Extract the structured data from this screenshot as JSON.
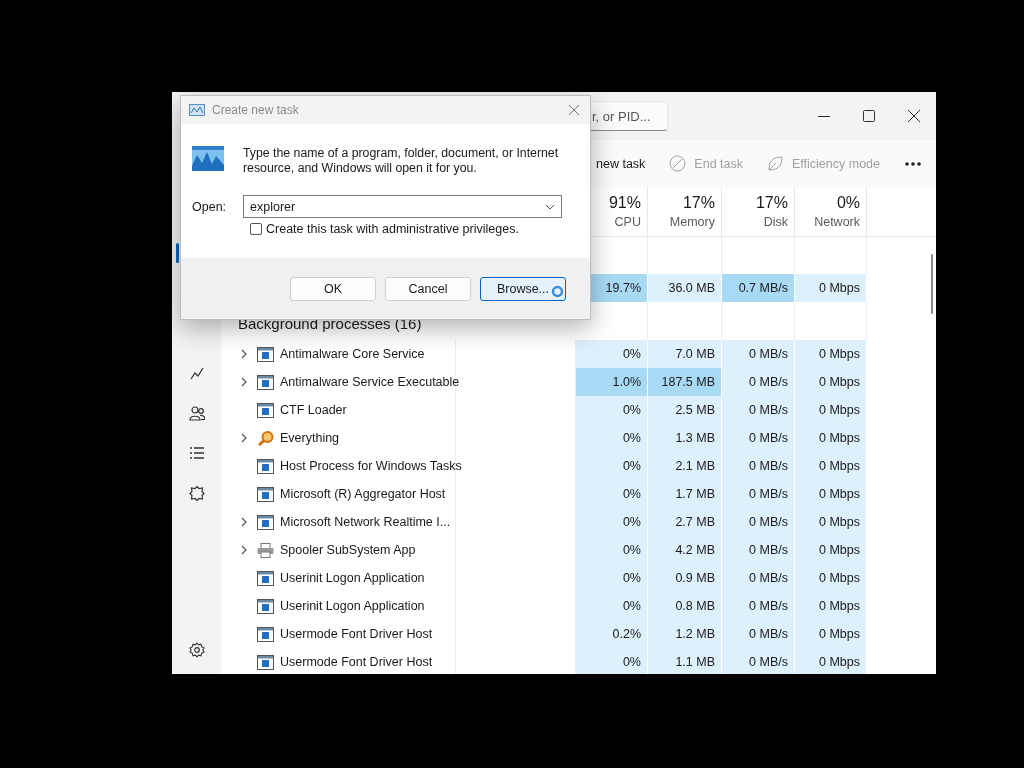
{
  "dialog": {
    "title": "Create new task",
    "message": "Type the name of a program, folder, document, or Internet resource, and Windows will open it for you.",
    "open_label": "Open:",
    "open_value": "explorer",
    "admin_label": "Create this task with administrative privileges.",
    "admin_checked": false,
    "buttons": [
      {
        "label": "OK",
        "focused": false
      },
      {
        "label": "Cancel",
        "focused": false
      },
      {
        "label": "Browse...",
        "focused": true
      }
    ]
  },
  "window": {
    "search_placeholder": "r, or PID..."
  },
  "sidebar": {
    "items": [
      {
        "kind": "processes",
        "selected": true
      },
      {
        "kind": "startup",
        "selected": false
      },
      {
        "kind": "users",
        "selected": false
      },
      {
        "kind": "details",
        "selected": false
      },
      {
        "kind": "services",
        "selected": false
      }
    ]
  },
  "toolbar": [
    {
      "kind": "text",
      "label": "new task",
      "disabled": false
    },
    {
      "kind": "end",
      "label": "End task",
      "disabled": true
    },
    {
      "kind": "leaf",
      "label": "Efficiency mode",
      "disabled": true
    },
    {
      "kind": "more"
    }
  ],
  "columns": [
    {
      "percent": "91%",
      "label": "CPU"
    },
    {
      "percent": "17%",
      "label": "Memory"
    },
    {
      "percent": "17%",
      "label": "Disk"
    },
    {
      "percent": "0%",
      "label": "Network"
    }
  ],
  "apps_row": {
    "cells": [
      {
        "text": "19.7%",
        "hot": true
      },
      {
        "text": "36.0 MB",
        "hot": false
      },
      {
        "text": "0.7 MB/s",
        "hot": true
      },
      {
        "text": "0 Mbps",
        "hot": false
      }
    ]
  },
  "group": {
    "label": "Background processes (16)"
  },
  "processes": [
    {
      "name": "Antimalware Core Service",
      "expandable": true,
      "kind": "app",
      "cells": [
        {
          "text": "0%",
          "hot": false
        },
        {
          "text": "7.0 MB",
          "hot": false
        },
        {
          "text": "0 MB/s",
          "hot": false
        },
        {
          "text": "0 Mbps",
          "hot": false
        }
      ]
    },
    {
      "name": "Antimalware Service Executable",
      "expandable": true,
      "kind": "app",
      "cells": [
        {
          "text": "1.0%",
          "hot": true
        },
        {
          "text": "187.5 MB",
          "hot": true
        },
        {
          "text": "0 MB/s",
          "hot": false
        },
        {
          "text": "0 Mbps",
          "hot": false
        }
      ]
    },
    {
      "name": "CTF Loader",
      "expandable": false,
      "kind": "app",
      "cells": [
        {
          "text": "0%",
          "hot": false
        },
        {
          "text": "2.5 MB",
          "hot": false
        },
        {
          "text": "0 MB/s",
          "hot": false
        },
        {
          "text": "0 Mbps",
          "hot": false
        }
      ]
    },
    {
      "name": "Everything",
      "expandable": true,
      "kind": "magnifier",
      "cells": [
        {
          "text": "0%",
          "hot": false
        },
        {
          "text": "1.3 MB",
          "hot": false
        },
        {
          "text": "0 MB/s",
          "hot": false
        },
        {
          "text": "0 Mbps",
          "hot": false
        }
      ]
    },
    {
      "name": "Host Process for Windows Tasks",
      "expandable": false,
      "kind": "app",
      "cells": [
        {
          "text": "0%",
          "hot": false
        },
        {
          "text": "2.1 MB",
          "hot": false
        },
        {
          "text": "0 MB/s",
          "hot": false
        },
        {
          "text": "0 Mbps",
          "hot": false
        }
      ]
    },
    {
      "name": "Microsoft (R) Aggregator Host",
      "expandable": false,
      "kind": "app",
      "cells": [
        {
          "text": "0%",
          "hot": false
        },
        {
          "text": "1.7 MB",
          "hot": false
        },
        {
          "text": "0 MB/s",
          "hot": false
        },
        {
          "text": "0 Mbps",
          "hot": false
        }
      ]
    },
    {
      "name": "Microsoft Network Realtime I...",
      "expandable": true,
      "kind": "app",
      "cells": [
        {
          "text": "0%",
          "hot": false
        },
        {
          "text": "2.7 MB",
          "hot": false
        },
        {
          "text": "0 MB/s",
          "hot": false
        },
        {
          "text": "0 Mbps",
          "hot": false
        }
      ]
    },
    {
      "name": "Spooler SubSystem App",
      "expandable": true,
      "kind": "printer",
      "cells": [
        {
          "text": "0%",
          "hot": false
        },
        {
          "text": "4.2 MB",
          "hot": false
        },
        {
          "text": "0 MB/s",
          "hot": false
        },
        {
          "text": "0 Mbps",
          "hot": false
        }
      ]
    },
    {
      "name": "Userinit Logon Application",
      "expandable": false,
      "kind": "app",
      "cells": [
        {
          "text": "0%",
          "hot": false
        },
        {
          "text": "0.9 MB",
          "hot": false
        },
        {
          "text": "0 MB/s",
          "hot": false
        },
        {
          "text": "0 Mbps",
          "hot": false
        }
      ]
    },
    {
      "name": "Userinit Logon Application",
      "expandable": false,
      "kind": "app",
      "cells": [
        {
          "text": "0%",
          "hot": false
        },
        {
          "text": "0.8 MB",
          "hot": false
        },
        {
          "text": "0 MB/s",
          "hot": false
        },
        {
          "text": "0 Mbps",
          "hot": false
        }
      ]
    },
    {
      "name": "Usermode Font Driver Host",
      "expandable": false,
      "kind": "app",
      "cells": [
        {
          "text": "0.2%",
          "hot": false
        },
        {
          "text": "1.2 MB",
          "hot": false
        },
        {
          "text": "0 MB/s",
          "hot": false
        },
        {
          "text": "0 Mbps",
          "hot": false
        }
      ]
    },
    {
      "name": "Usermode Font Driver Host",
      "expandable": false,
      "kind": "app",
      "cells": [
        {
          "text": "0%",
          "hot": false
        },
        {
          "text": "1.1 MB",
          "hot": false
        },
        {
          "text": "0 MB/s",
          "hot": false
        },
        {
          "text": "0 Mbps",
          "hot": false
        }
      ]
    }
  ]
}
